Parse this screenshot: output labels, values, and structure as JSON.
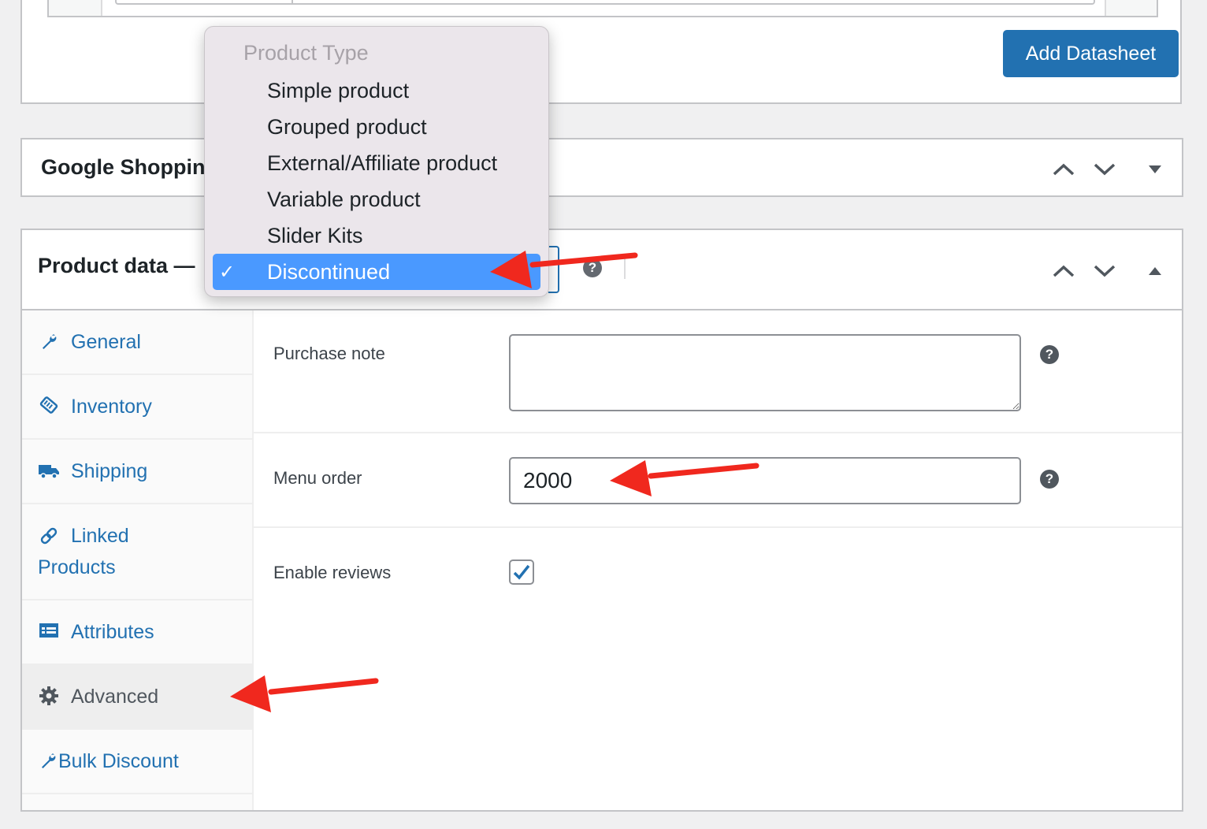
{
  "datasheet": {
    "add_button": "Add Datasheet"
  },
  "google_shopping": {
    "title": "Google Shoppin"
  },
  "product_data": {
    "title": "Product data —",
    "help_glyph": "?",
    "product_type_dropdown": {
      "group_label": "Product Type",
      "options": [
        {
          "label": "Simple product",
          "selected": false
        },
        {
          "label": "Grouped product",
          "selected": false
        },
        {
          "label": "External/Affiliate product",
          "selected": false
        },
        {
          "label": "Variable product",
          "selected": false
        },
        {
          "label": "Slider Kits",
          "selected": false
        },
        {
          "label": "Discontinued",
          "selected": true
        }
      ],
      "check_glyph": "✓",
      "selected_color": "#4a99ff"
    },
    "tabs": [
      {
        "label": "General",
        "icon": "wrench-icon"
      },
      {
        "label": "Inventory",
        "icon": "tag-icon"
      },
      {
        "label": "Shipping",
        "icon": "truck-icon"
      },
      {
        "label": "Linked",
        "label2": "Products",
        "icon": "link-icon"
      },
      {
        "label": "Attributes",
        "icon": "list-table-icon"
      },
      {
        "label": "Advanced",
        "icon": "gear-icon",
        "active": true
      },
      {
        "label": "Bulk Discount",
        "icon": "wrench-icon"
      }
    ],
    "advanced": {
      "purchase_note_label": "Purchase note",
      "purchase_note_value": "",
      "menu_order_label": "Menu order",
      "menu_order_value": "2000",
      "enable_reviews_label": "Enable reviews",
      "enable_reviews_checked": true
    }
  },
  "colors": {
    "accent": "#2271b1",
    "annotation_arrow": "#f0281e"
  }
}
